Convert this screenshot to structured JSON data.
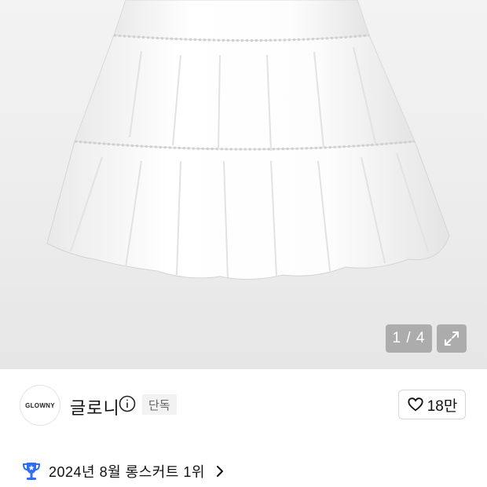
{
  "gallery": {
    "image_alt_icon": "skirt-image",
    "counter": "1 / 4",
    "expand_icon": "expand-icon"
  },
  "brand": {
    "logo_text": "GLOWNY",
    "name": "글로니",
    "info_icon": "info-icon",
    "badge": "단독"
  },
  "like": {
    "icon": "heart-icon",
    "count": "18만"
  },
  "ranking": {
    "icon": "trophy-icon",
    "text": "2024년 8월 롱스커트 1위",
    "chevron_icon": "chevron-right-icon"
  },
  "colors": {
    "trophy_blue": "#2f6df6",
    "overlay_gray": "#969696"
  }
}
